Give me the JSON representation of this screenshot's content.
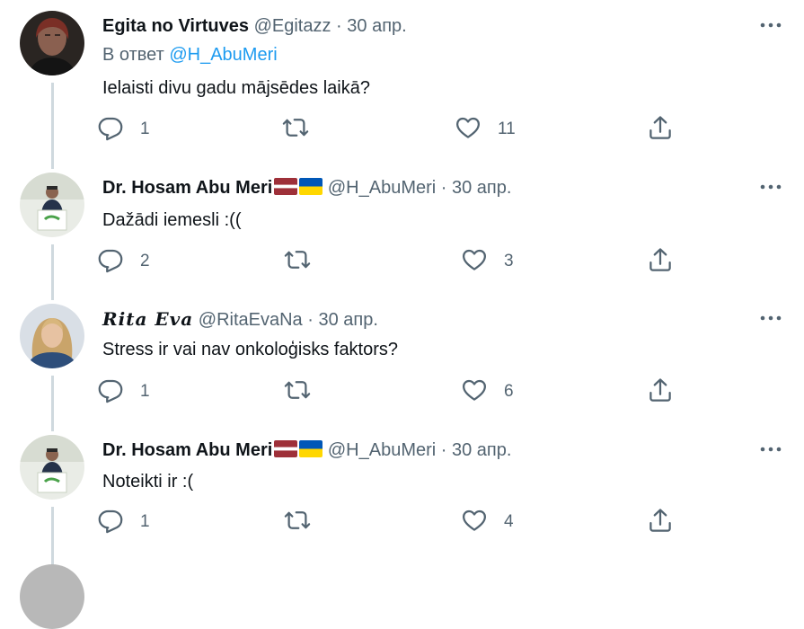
{
  "tweets": [
    {
      "name": "Egita no Virtuves",
      "handle": "@Egitazz",
      "sep": "·",
      "date": "30 апр.",
      "reply_prefix": "В ответ",
      "reply_handle": "@H_AbuMeri",
      "text": "Ielaisti divu gadu mājsēdes laikā?",
      "replies": "1",
      "retweets": "",
      "likes": "11"
    },
    {
      "name": "Dr. Hosam Abu Meri",
      "handle": "@H_AbuMeri",
      "sep": "·",
      "date": "30 апр.",
      "flags": [
        "latvia-flag",
        "ukraine-flag"
      ],
      "text": "Dažādi iemesli :((",
      "replies": "2",
      "retweets": "",
      "likes": "3"
    },
    {
      "name": "𝑹𝒊𝒕𝒂 𝑬𝒗𝒂",
      "handle": "@RitaEvaNa",
      "sep": "·",
      "date": "30 апр.",
      "text": "Stress ir vai nav onkoloģisks faktors?",
      "replies": "1",
      "retweets": "",
      "likes": "6"
    },
    {
      "name": "Dr. Hosam Abu Meri",
      "handle": "@H_AbuMeri",
      "sep": "·",
      "date": "30 апр.",
      "flags": [
        "latvia-flag",
        "ukraine-flag"
      ],
      "text": "Noteikti ir :(",
      "replies": "1",
      "retweets": "",
      "likes": "4"
    }
  ],
  "colors": {
    "accent": "#1d9bf0",
    "secondary_text": "#536471",
    "thread_line": "#cfd9de",
    "latvia": "#9e3039",
    "ukraine_blue": "#0057b7",
    "ukraine_yellow": "#ffd700"
  },
  "icons": [
    "more-icon",
    "reply-icon",
    "retweet-icon",
    "like-icon",
    "share-icon"
  ]
}
